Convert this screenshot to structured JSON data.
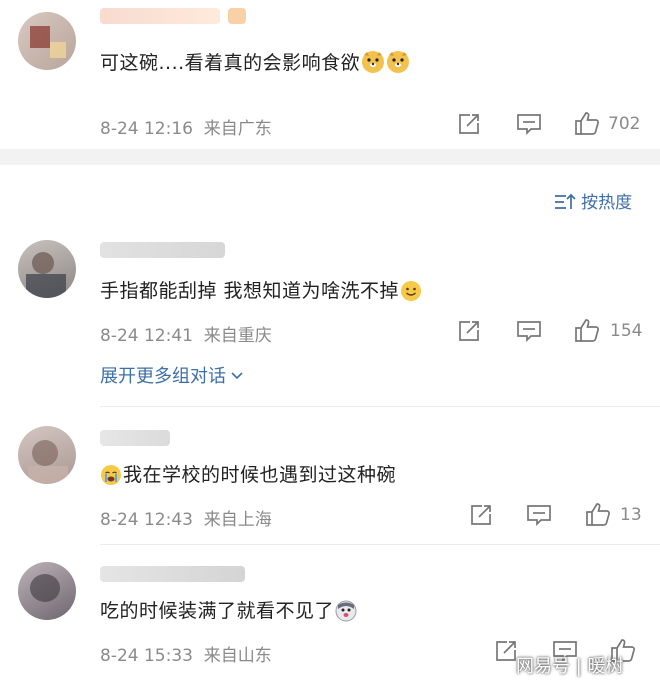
{
  "sort": {
    "label": "按热度"
  },
  "expand": {
    "label": "展开更多组对话"
  },
  "comments": [
    {
      "text": "可这碗....看着真的会影响食欲",
      "time": "8-24 12:16",
      "location": "来自广东",
      "likes": "702"
    },
    {
      "text": "手指都能刮掉  我想知道为啥洗不掉",
      "time": "8-24 12:41",
      "location": "来自重庆",
      "likes": "154"
    },
    {
      "text": "我在学校的时候也遇到过这种碗",
      "time": "8-24 12:43",
      "location": "来自上海",
      "likes": "13"
    },
    {
      "text": "吃的时候装满了就看不见了",
      "time": "8-24 15:33",
      "location": "来自山东",
      "likes": ""
    }
  ],
  "watermark": {
    "text": "网易号 | 暖树"
  },
  "icons": {
    "repost": "repost-icon",
    "comment": "comment-icon",
    "like": "thumbs-up-icon",
    "sort": "sort-icon"
  },
  "colors": {
    "link": "#3d6fa8",
    "meta": "#8a8a8a",
    "separator": "#f2f2f2"
  }
}
